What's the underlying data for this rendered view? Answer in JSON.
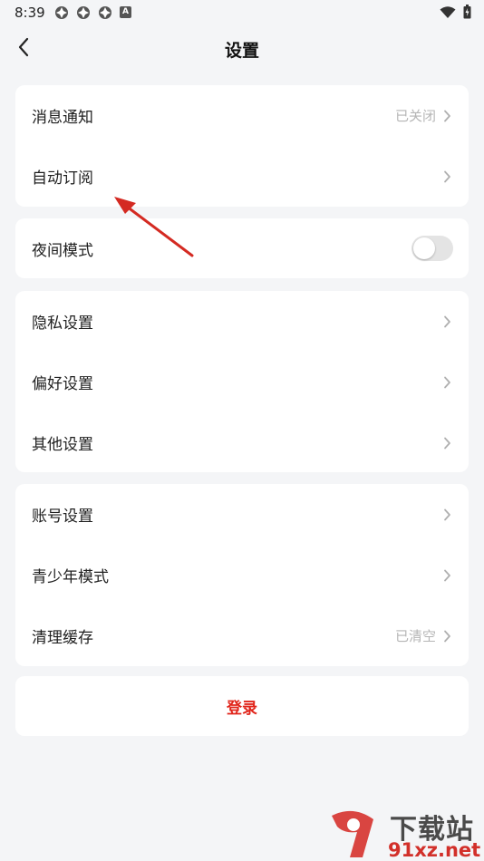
{
  "status_bar": {
    "time": "8:39",
    "notification_icons": [
      "app-icon",
      "app-icon",
      "app-icon",
      "a-badge-icon"
    ],
    "a_badge_text": "A",
    "right_icons": [
      "wifi-icon",
      "battery-icon"
    ]
  },
  "header": {
    "title": "设置",
    "back_icon": "chevron-left-icon"
  },
  "groups": [
    {
      "items": [
        {
          "label": "消息通知",
          "value": "已关闭",
          "accessory": "chevron-right-icon"
        },
        {
          "label": "自动订阅",
          "value": "",
          "accessory": "chevron-right-icon"
        }
      ]
    },
    {
      "items": [
        {
          "label": "夜间模式",
          "toggle": false
        }
      ]
    },
    {
      "items": [
        {
          "label": "隐私设置",
          "accessory": "chevron-right-icon"
        },
        {
          "label": "偏好设置",
          "accessory": "chevron-right-icon"
        },
        {
          "label": "其他设置",
          "accessory": "chevron-right-icon"
        }
      ]
    },
    {
      "items": [
        {
          "label": "账号设置",
          "accessory": "chevron-right-icon"
        },
        {
          "label": "青少年模式",
          "accessory": "chevron-right-icon"
        },
        {
          "label": "清理缓存",
          "value": "已清空",
          "accessory": "chevron-right-icon"
        }
      ]
    }
  ],
  "login_button": {
    "label": "登录"
  },
  "watermark": {
    "brand": "下载站",
    "url": "91xz.net",
    "logo_text": "9"
  },
  "colors": {
    "background": "#f4f5f7",
    "card": "#ffffff",
    "accent_red": "#e1251b",
    "secondary_text": "#b5b5b5",
    "annotation_arrow": "#d42a22"
  }
}
